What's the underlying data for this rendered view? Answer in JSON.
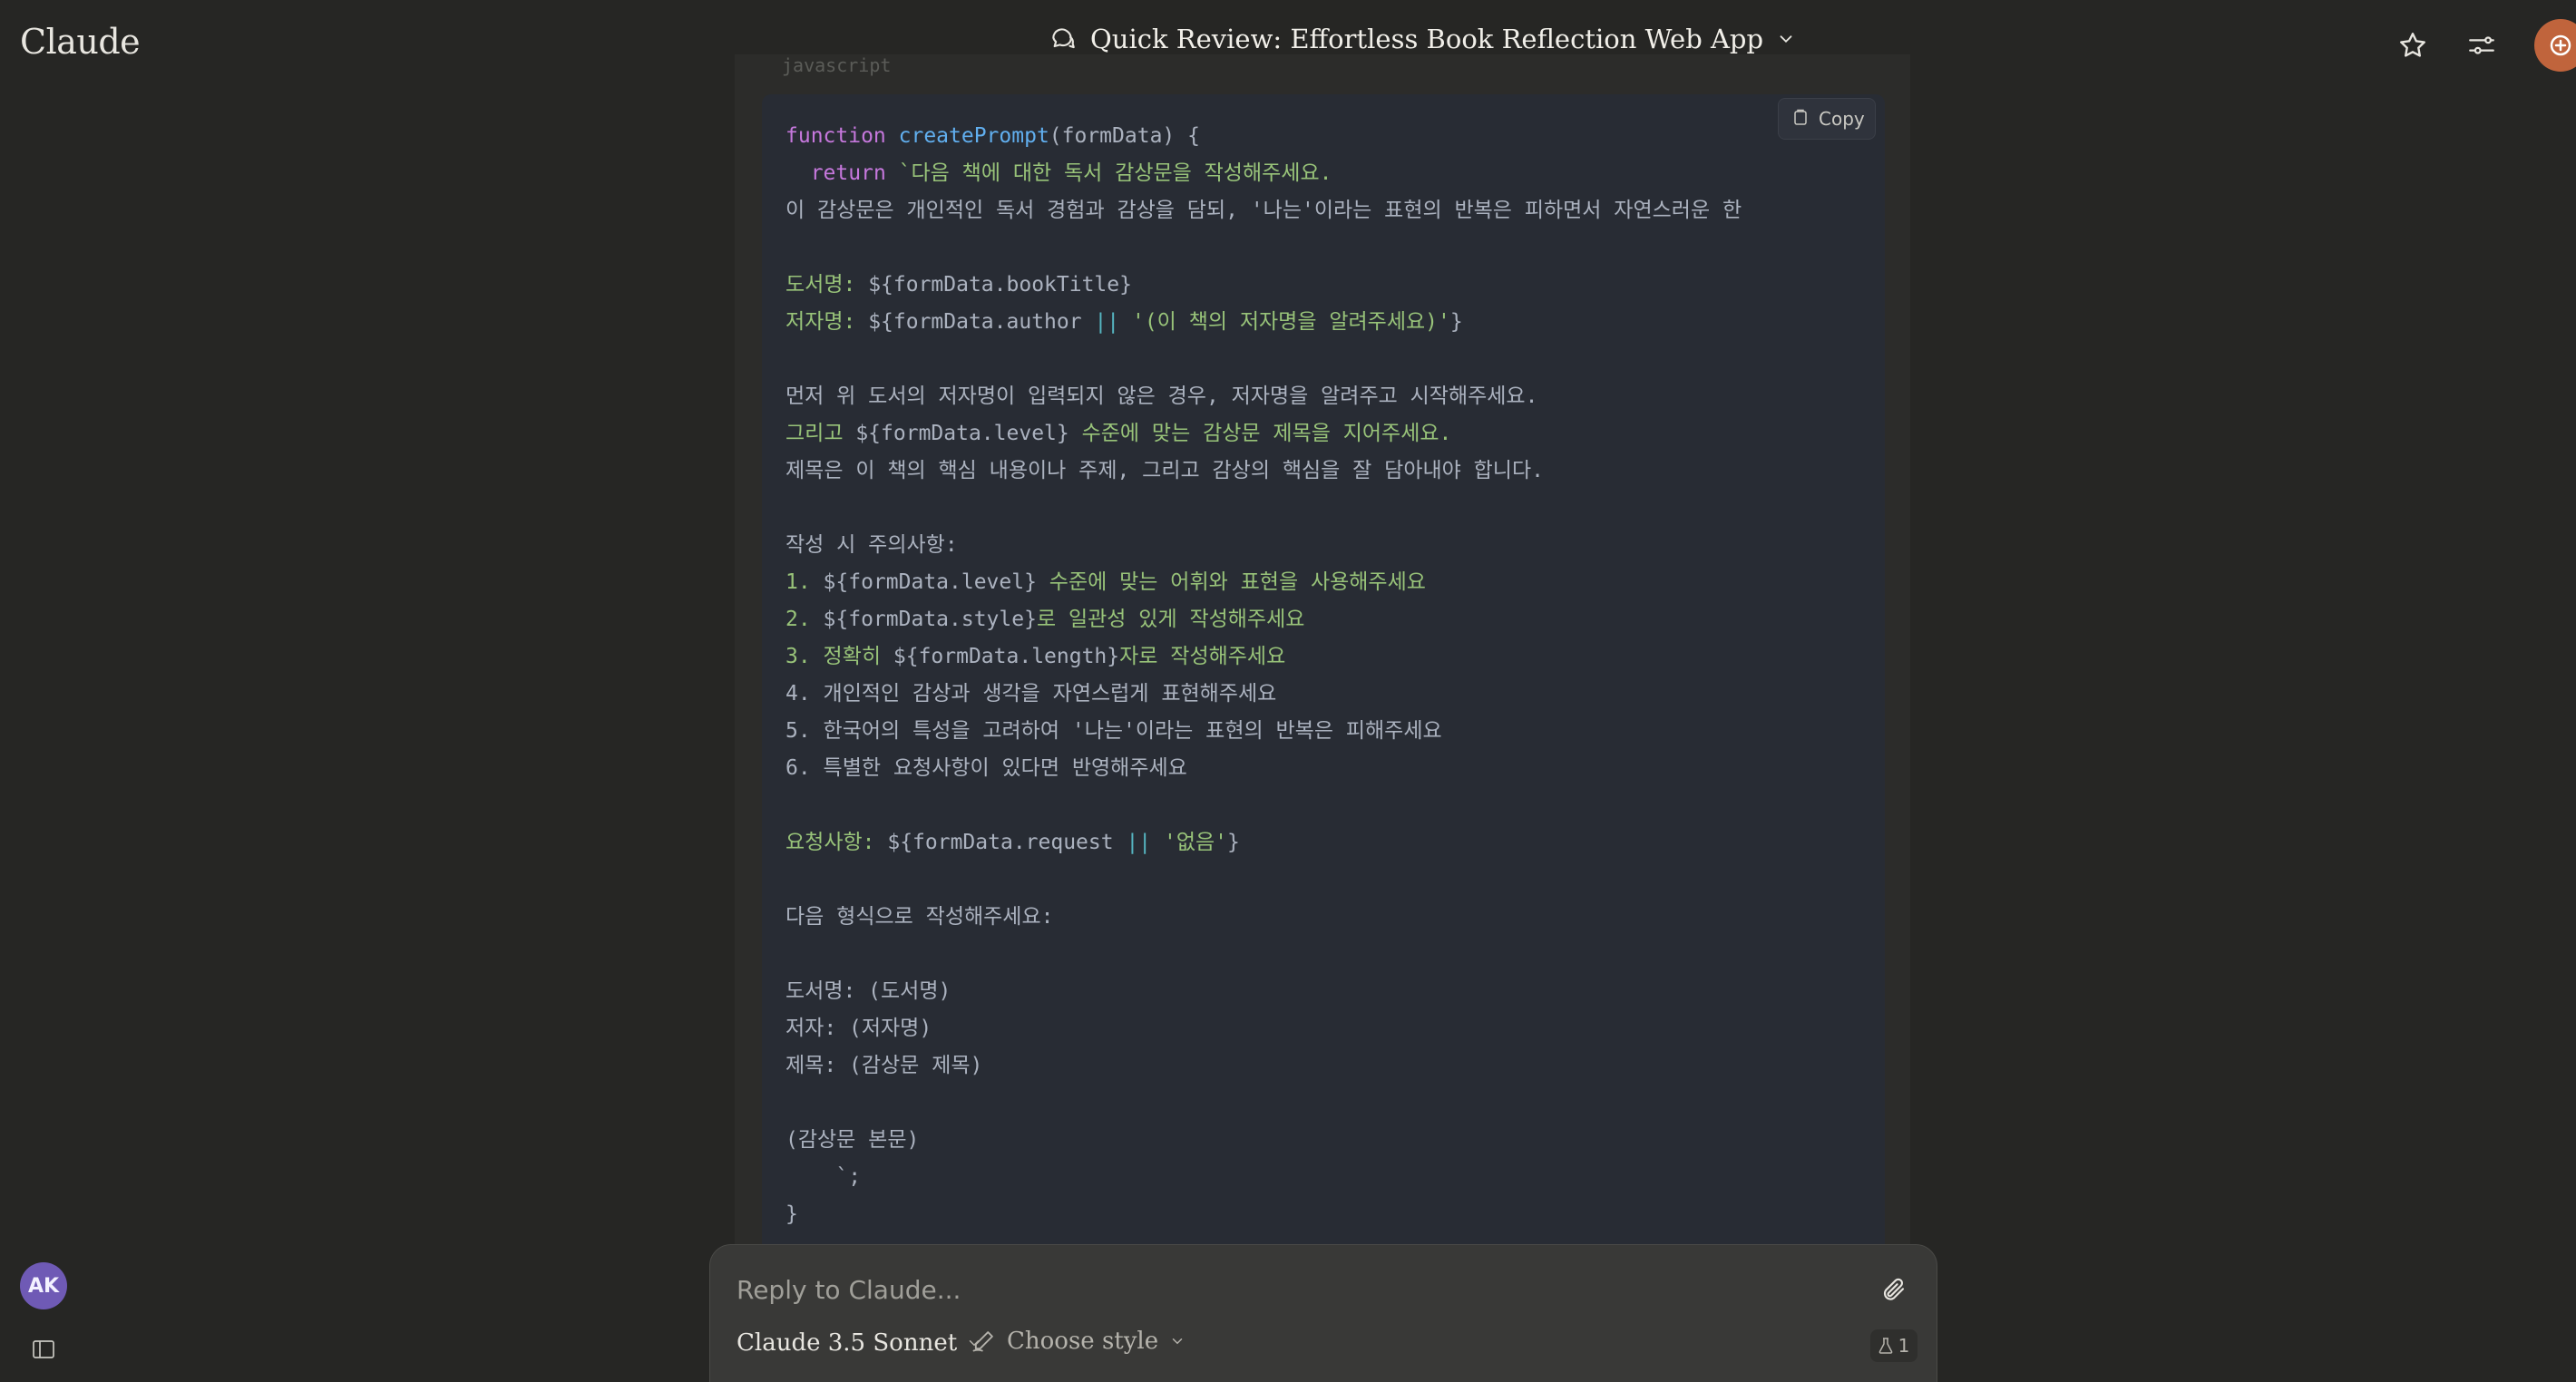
{
  "app": {
    "brand": "Claude"
  },
  "header": {
    "title": "Quick Review: Effortless Book Reflection Web App",
    "icons": [
      "chat-icon",
      "chevron-down-icon",
      "star-icon",
      "sliders-icon",
      "new-chat-icon"
    ]
  },
  "code": {
    "language": "javascript",
    "copy_label": "Copy",
    "lines": [
      [
        {
          "t": "function ",
          "c": "kw"
        },
        {
          "t": "createPrompt",
          "c": "fn"
        },
        {
          "t": "(formData) {",
          "c": "tx"
        }
      ],
      [
        {
          "t": "  ",
          "c": "tx"
        },
        {
          "t": "return",
          "c": "kw"
        },
        {
          "t": " `다음 책에 대한 독서 감상문을 작성해주세요.",
          "c": "st"
        }
      ],
      [
        {
          "t": "이 감상문은 개인적인 독서 경험과 감상을 담되, '나는'이라는 표현의 반복은 피하면서 자연스러운 한",
          "c": "tx"
        }
      ],
      [],
      [
        {
          "t": "도서명: ",
          "c": "st"
        },
        {
          "t": "${formData.bookTitle}",
          "c": "tx"
        }
      ],
      [
        {
          "t": "저자명: ",
          "c": "st"
        },
        {
          "t": "${formData.author ",
          "c": "tx"
        },
        {
          "t": "||",
          "c": "op"
        },
        {
          "t": " '(이 책의 저자명을 알려주세요)'",
          "c": "st"
        },
        {
          "t": "}",
          "c": "tx"
        }
      ],
      [],
      [
        {
          "t": "먼저 위 도서의 저자명이 입력되지 않은 경우, 저자명을 알려주고 시작해주세요.",
          "c": "tx"
        }
      ],
      [
        {
          "t": "그리고 ",
          "c": "st"
        },
        {
          "t": "${formData.level}",
          "c": "tx"
        },
        {
          "t": " 수준에 맞는 감상문 제목을 지어주세요.",
          "c": "st"
        }
      ],
      [
        {
          "t": "제목은 이 책의 핵심 내용이나 주제, 그리고 감상의 핵심을 잘 담아내야 합니다.",
          "c": "tx"
        }
      ],
      [],
      [
        {
          "t": "작성 시 주의사항:",
          "c": "tx"
        }
      ],
      [
        {
          "t": "1. ",
          "c": "st"
        },
        {
          "t": "${formData.level}",
          "c": "tx"
        },
        {
          "t": " 수준에 맞는 어휘와 표현을 사용해주세요",
          "c": "st"
        }
      ],
      [
        {
          "t": "2. ",
          "c": "st"
        },
        {
          "t": "${formData.style}",
          "c": "tx"
        },
        {
          "t": "로 일관성 있게 작성해주세요",
          "c": "st"
        }
      ],
      [
        {
          "t": "3. 정확히 ",
          "c": "st"
        },
        {
          "t": "${formData.length}",
          "c": "tx"
        },
        {
          "t": "자로 작성해주세요",
          "c": "st"
        }
      ],
      [
        {
          "t": "4. 개인적인 감상과 생각을 자연스럽게 표현해주세요",
          "c": "tx"
        }
      ],
      [
        {
          "t": "5. 한국어의 특성을 고려하여 '나는'이라는 표현의 반복은 피해주세요",
          "c": "tx"
        }
      ],
      [
        {
          "t": "6. 특별한 요청사항이 있다면 반영해주세요",
          "c": "tx"
        }
      ],
      [],
      [
        {
          "t": "요청사항: ",
          "c": "st"
        },
        {
          "t": "${formData.request ",
          "c": "tx"
        },
        {
          "t": "||",
          "c": "op"
        },
        {
          "t": " '없음'",
          "c": "st"
        },
        {
          "t": "}",
          "c": "tx"
        }
      ],
      [],
      [
        {
          "t": "다음 형식으로 작성해주세요:",
          "c": "tx"
        }
      ],
      [],
      [
        {
          "t": "도서명: (도서명)",
          "c": "tx"
        }
      ],
      [
        {
          "t": "저자: (저자명)",
          "c": "tx"
        }
      ],
      [
        {
          "t": "제목: (감상문 제목)",
          "c": "tx"
        }
      ],
      [],
      [
        {
          "t": "(감상문 본문)",
          "c": "tx"
        }
      ],
      [
        {
          "t": "    `;",
          "c": "tx"
        }
      ],
      [
        {
          "t": "}",
          "c": "tx"
        }
      ]
    ]
  },
  "composer": {
    "placeholder": "Reply to Claude...",
    "model": "Claude 3.5 Sonnet",
    "style": "Choose style",
    "badge_count": "1"
  },
  "user": {
    "initials": "AK"
  },
  "colors": {
    "background": "#262624",
    "code_bg": "#282c34",
    "accent": "#c0643c",
    "avatar": "#6f5ab5"
  }
}
